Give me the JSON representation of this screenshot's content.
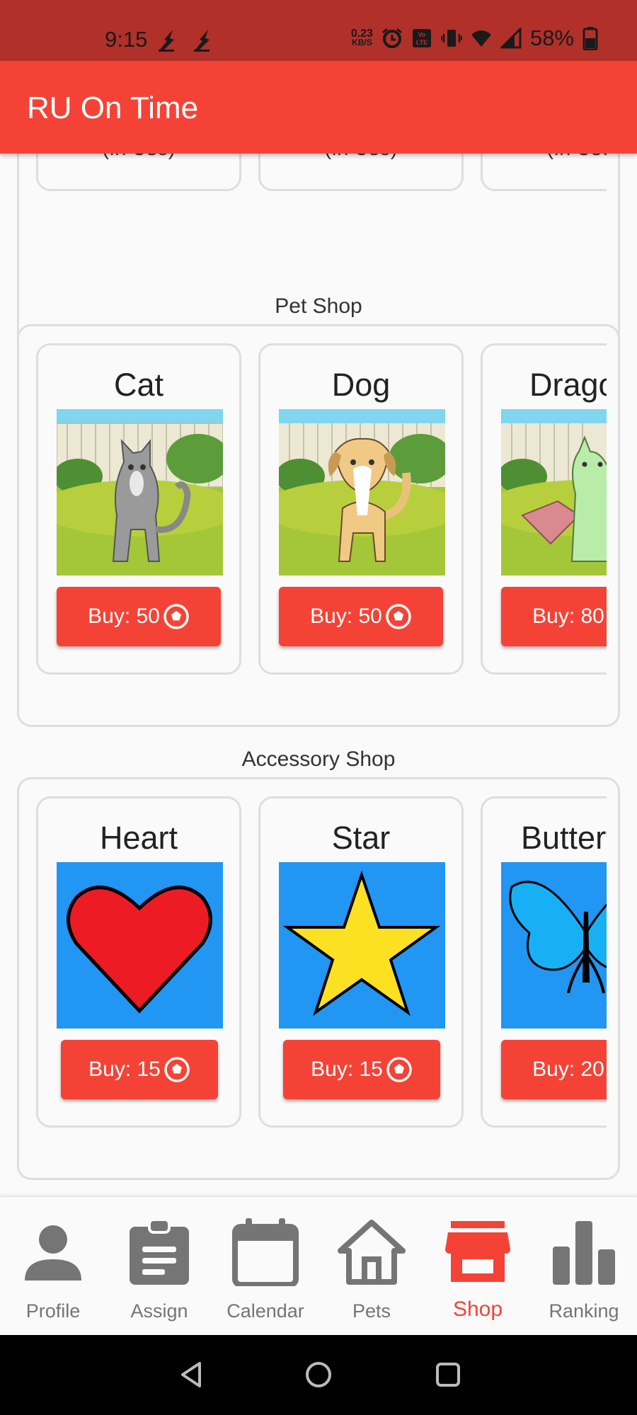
{
  "status_bar": {
    "time": "9:15",
    "net_speed_value": "0.23",
    "net_speed_unit": "KB/S",
    "battery": "58%"
  },
  "app_bar": {
    "title": "RU On Time"
  },
  "background_section": {
    "cards": [
      {
        "status": "(In Use)"
      },
      {
        "status": "(In Use)"
      },
      {
        "status": "(In Use)"
      }
    ]
  },
  "pet_shop": {
    "title": "Pet Shop",
    "items": [
      {
        "name": "Cat",
        "buy_label": "Buy: 50"
      },
      {
        "name": "Dog",
        "buy_label": "Buy: 50"
      },
      {
        "name": "Dragon",
        "buy_label": "Buy: 80"
      }
    ]
  },
  "accessory_shop": {
    "title": "Accessory Shop",
    "items": [
      {
        "name": "Heart",
        "buy_label": "Buy: 15"
      },
      {
        "name": "Star",
        "buy_label": "Buy: 15"
      },
      {
        "name": "Butterfly",
        "buy_label": "Buy: 20"
      }
    ]
  },
  "bottom_nav": {
    "items": [
      {
        "label": "Profile",
        "icon": "person-icon"
      },
      {
        "label": "Assign",
        "icon": "clipboard-icon"
      },
      {
        "label": "Calendar",
        "icon": "calendar-icon"
      },
      {
        "label": "Pets",
        "icon": "house-icon"
      },
      {
        "label": "Shop",
        "icon": "store-icon",
        "active": true
      },
      {
        "label": "Ranking",
        "icon": "bar-chart-icon"
      }
    ]
  },
  "colors": {
    "primary": "#f44336",
    "status_bar": "#b1302a",
    "nav_inactive": "#757575",
    "accessory_bg": "#2196f3"
  }
}
